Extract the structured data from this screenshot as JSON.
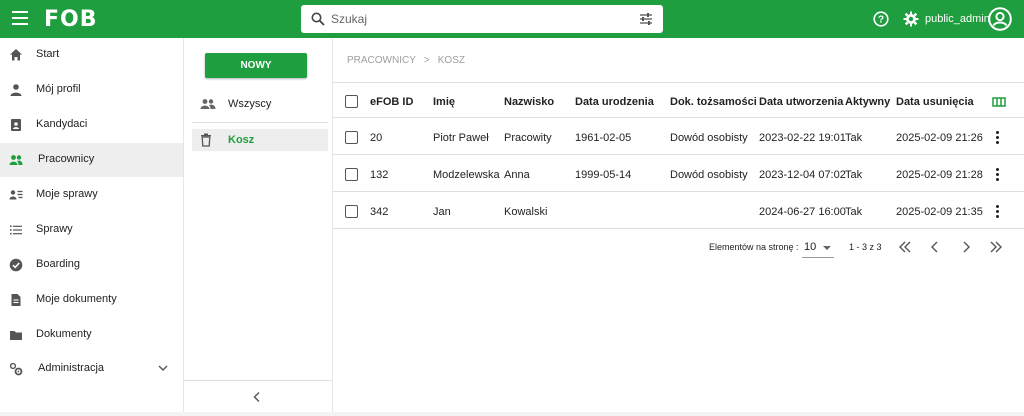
{
  "app": {
    "logo": "FOB",
    "brand_color": "#1e9e3e"
  },
  "search": {
    "placeholder": "Szukaj",
    "value": ""
  },
  "user": {
    "name": "public_admin"
  },
  "sidebar": {
    "items": [
      {
        "label": "Start",
        "icon": "home-icon"
      },
      {
        "label": "Mój profil",
        "icon": "person-icon"
      },
      {
        "label": "Kandydaci",
        "icon": "badge-icon"
      },
      {
        "label": "Pracownicy",
        "icon": "people-icon",
        "active": true
      },
      {
        "label": "Moje sprawy",
        "icon": "person-list-icon"
      },
      {
        "label": "Sprawy",
        "icon": "list-icon"
      },
      {
        "label": "Boarding",
        "icon": "check-circle-icon"
      },
      {
        "label": "Moje dokumenty",
        "icon": "document-icon"
      },
      {
        "label": "Dokumenty",
        "icon": "folder-icon"
      },
      {
        "label": "Administracja",
        "icon": "settings-cogs-icon",
        "expandable": true
      }
    ]
  },
  "mid": {
    "new_button": "NOWY",
    "folders": [
      {
        "label": "Wszyscy",
        "icon": "people-icon"
      },
      {
        "label": "Kosz",
        "icon": "trash-icon",
        "active": true
      }
    ]
  },
  "breadcrumb": {
    "root": "PRACOWNICY",
    "separator": ">",
    "current": "KOSZ"
  },
  "table": {
    "headers": [
      "eFOB ID",
      "Imię",
      "Nazwisko",
      "Data urodzenia",
      "Dok. tożsamości",
      "Data utworzenia",
      "Aktywny",
      "Data usunięcia"
    ],
    "rows": [
      [
        "20",
        "Piotr Paweł",
        "Pracowity",
        "1961-02-05",
        "Dowód osobisty",
        "2023-02-22 19:01",
        "Tak",
        "2025-02-09 21:26"
      ],
      [
        "132",
        "Modzelewska",
        "Anna",
        "1999-05-14",
        "Dowód osobisty",
        "2023-12-04 07:02",
        "Tak",
        "2025-02-09 21:28"
      ],
      [
        "342",
        "Jan",
        "Kowalski",
        "",
        "",
        "2024-06-27 16:00",
        "Tak",
        "2025-02-09 21:35"
      ]
    ]
  },
  "pagination": {
    "per_page_label": "Elementów na stronę :",
    "per_page_value": "10",
    "range": "1 - 3 z 3"
  }
}
